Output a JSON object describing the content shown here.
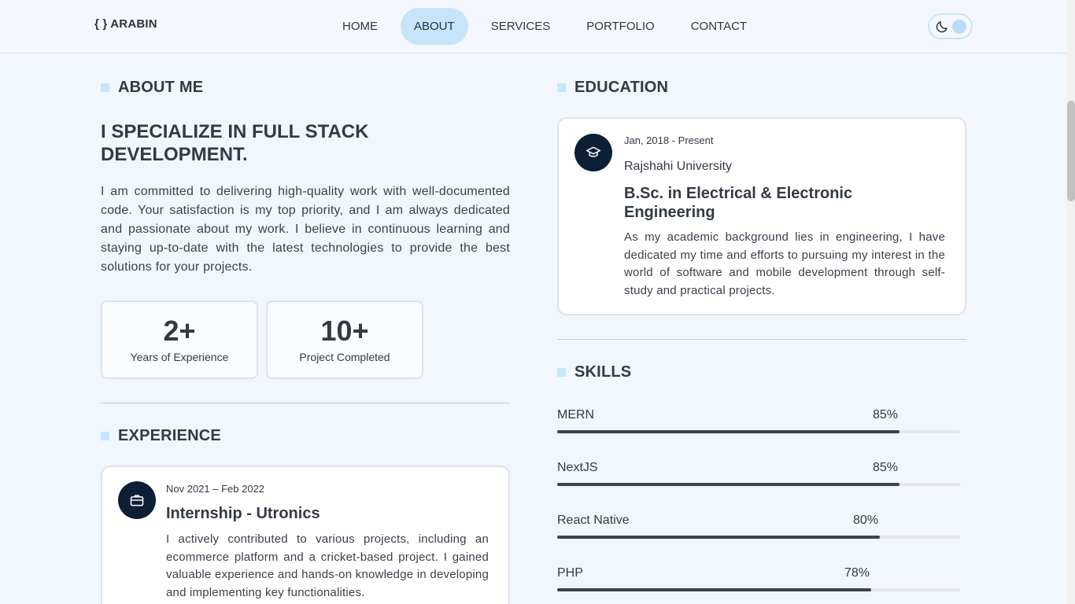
{
  "header": {
    "logo": "{ } ARABIN",
    "nav": [
      "HOME",
      "ABOUT",
      "SERVICES",
      "PORTFOLIO",
      "CONTACT"
    ],
    "active_nav": "ABOUT",
    "theme_toggle_icon": "moon-icon"
  },
  "about": {
    "heading": "ABOUT ME",
    "tagline": "I SPECIALIZE IN FULL STACK DEVELOPMENT.",
    "paragraph": "I am committed to delivering high-quality work with well-documented code. Your satisfaction is my top priority, and I am always dedicated and passionate about my work. I believe in continuous learning and staying up-to-date with the latest technologies to provide the best solutions for your projects.",
    "stats": [
      {
        "value": "2+",
        "label": "Years of Experience"
      },
      {
        "value": "10+",
        "label": "Project Completed"
      }
    ]
  },
  "experience": {
    "heading": "EXPERIENCE",
    "items": [
      {
        "date": "Nov 2021 – Feb 2022",
        "title": "Internship - Utronics",
        "description": "I actively contributed to various projects, including an ecommerce platform and a cricket-based project. I gained valuable experience and hands-on knowledge in developing and implementing key functionalities.",
        "icon": "briefcase-icon"
      }
    ]
  },
  "education": {
    "heading": "EDUCATION",
    "items": [
      {
        "date": "Jan, 2018 - Present",
        "institution": "Rajshahi University",
        "degree": "B.Sc. in Electrical & Electronic Engineering",
        "description": "As my academic background lies in engineering, I have dedicated my time and efforts to pursuing my interest in the world of software and mobile development through self-study and practical projects.",
        "icon": "graduation-cap-icon"
      }
    ]
  },
  "skills": {
    "heading": "SKILLS",
    "items": [
      {
        "name": "MERN",
        "percent": 85,
        "label": "85%"
      },
      {
        "name": "NextJS",
        "percent": 85,
        "label": "85%"
      },
      {
        "name": "React Native",
        "percent": 80,
        "label": "80%"
      },
      {
        "name": "PHP",
        "percent": 78,
        "label": "78%"
      }
    ]
  },
  "colors": {
    "accent": "#c6e5fb",
    "badge_bg": "#0c1f36",
    "bar_fill": "#3d424a",
    "page_bg": "#f2f6fd"
  }
}
